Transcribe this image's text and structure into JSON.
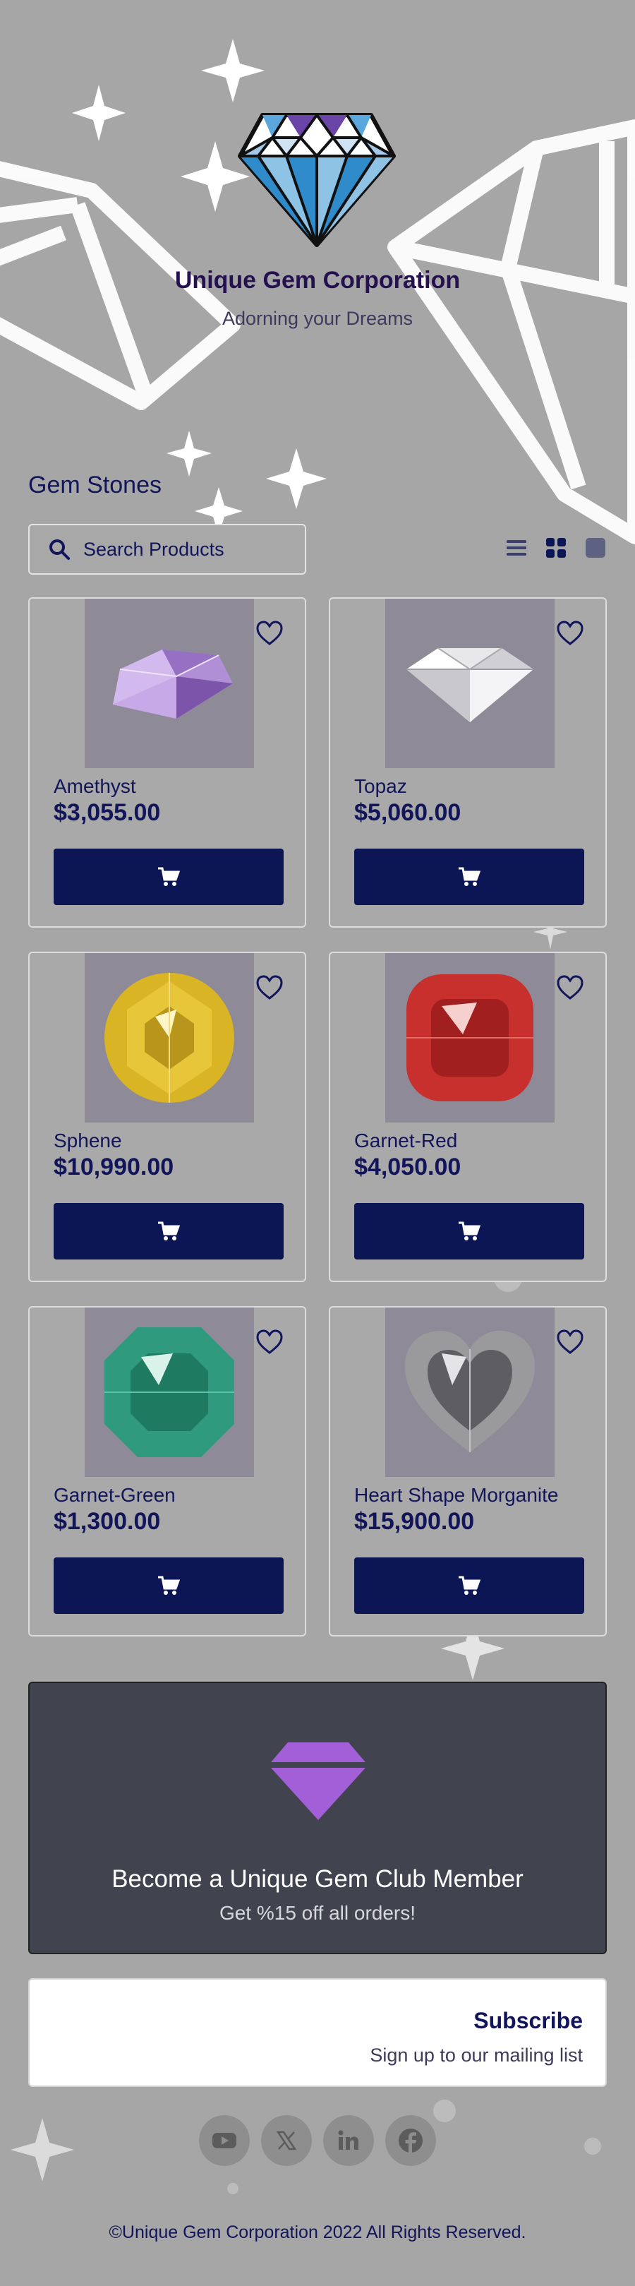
{
  "brand": {
    "company_name": "Unique Gem Corporation",
    "tagline": "Adorning your Dreams"
  },
  "catalog": {
    "title": "Gem Stones",
    "search_placeholder": "Search Products",
    "views": [
      "list-view",
      "grid-view",
      "single-view"
    ],
    "products": [
      {
        "name": "Amethyst",
        "price": "$3,055.00",
        "color": "#b18fd6",
        "shape": "round"
      },
      {
        "name": "Topaz",
        "price": "$5,060.00",
        "color": "#e8e8ea",
        "shape": "round"
      },
      {
        "name": "Sphene",
        "price": "$10,990.00",
        "color": "#d9b425",
        "shape": "circle"
      },
      {
        "name": "Garnet-Red",
        "price": "$4,050.00",
        "color": "#c8302e",
        "shape": "cushion"
      },
      {
        "name": "Garnet-Green",
        "price": "$1,300.00",
        "color": "#2f9a7d",
        "shape": "octagon"
      },
      {
        "name": "Heart Shape Morganite",
        "price": "$15,900.00",
        "color": "#9a9a9c",
        "shape": "heart"
      }
    ]
  },
  "club": {
    "title": "Become a Unique Gem Club Member",
    "subtitle": "Get %15 off all orders!",
    "gem_color": "#a25fd8"
  },
  "subscribe": {
    "title": "Subscribe",
    "subtitle": "Sign up to our mailing list"
  },
  "social": [
    "youtube-icon",
    "x-icon",
    "linkedin-icon",
    "facebook-icon"
  ],
  "footer": {
    "copyright": "©Unique Gem Corporation 2022 All Rights Reserved."
  },
  "colors": {
    "background": "#a6a6a6",
    "accent": "#0c1654",
    "text": "#12155a",
    "card_image_bg": "#8f8a98"
  }
}
